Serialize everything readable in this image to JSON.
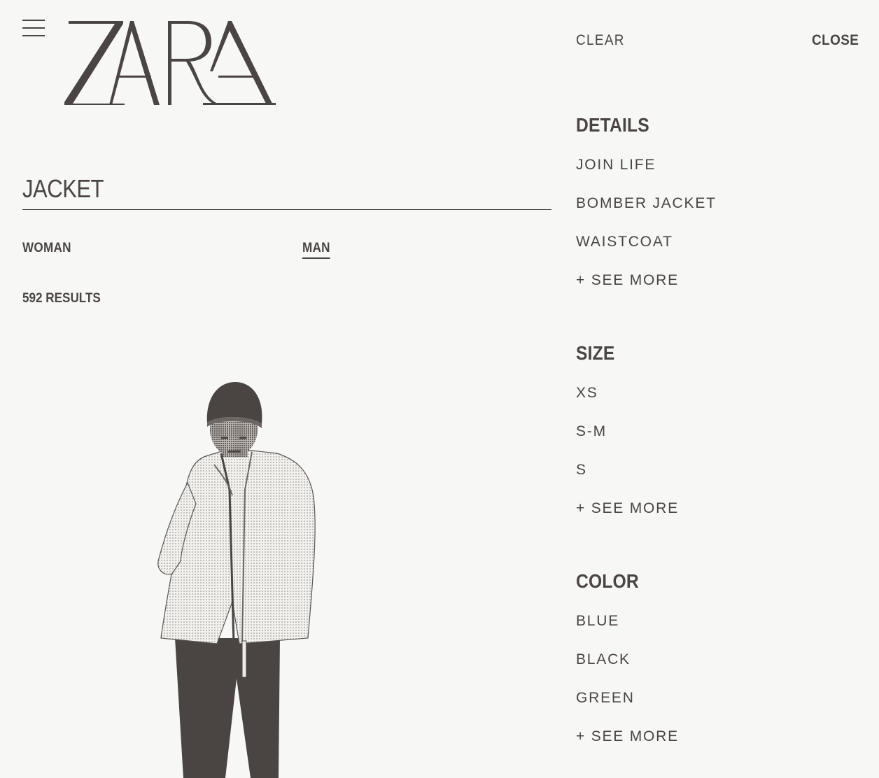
{
  "brand": "ZARA",
  "search": {
    "value": "JACKET"
  },
  "gender_tabs": [
    {
      "label": "WOMAN",
      "active": false
    },
    {
      "label": "MAN",
      "active": true
    }
  ],
  "results_label": "592 RESULTS",
  "panel": {
    "clear_label": "CLEAR",
    "close_label": "CLOSE",
    "sections": [
      {
        "heading": "DETAILS",
        "items": [
          "JOIN LIFE",
          "BOMBER JACKET",
          "WAISTCOAT"
        ],
        "see_more": "+ SEE MORE"
      },
      {
        "heading": "SIZE",
        "items": [
          "XS",
          "S-M",
          "S"
        ],
        "see_more": "+ SEE MORE"
      },
      {
        "heading": "COLOR",
        "items": [
          "BLUE",
          "BLACK",
          "GREEN"
        ],
        "see_more": "+ SEE MORE"
      }
    ]
  },
  "colors": {
    "text": "#4a4542",
    "background": "#f7f7f5"
  }
}
